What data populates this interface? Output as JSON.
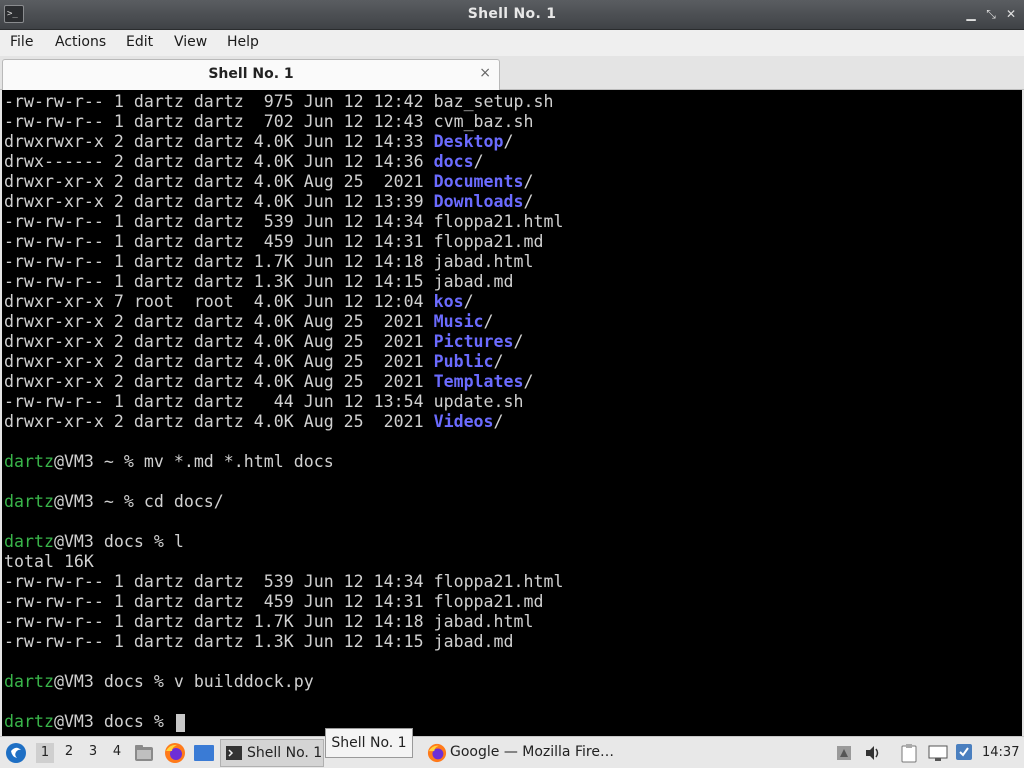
{
  "window": {
    "title": "Shell No. 1",
    "icon": "terminal-icon"
  },
  "menu": [
    "File",
    "Actions",
    "Edit",
    "View",
    "Help"
  ],
  "tab": {
    "label": "Shell No. 1",
    "close": "×"
  },
  "terminal": {
    "colors": {
      "directory": "#6b6bff",
      "user": "#39b54a",
      "text": "#d0d0d0"
    },
    "lines": [
      {
        "pre": "-rw-rw-r-- 1 dartz dartz  975 Jun 12 12:42 ",
        "name": "baz_setup.sh",
        "dir": false
      },
      {
        "pre": "-rw-rw-r-- 1 dartz dartz  702 Jun 12 12:43 ",
        "name": "cvm_baz.sh",
        "dir": false
      },
      {
        "pre": "drwxrwxr-x 2 dartz dartz 4.0K Jun 12 14:33 ",
        "name": "Desktop",
        "dir": true
      },
      {
        "pre": "drwx------ 2 dartz dartz 4.0K Jun 12 14:36 ",
        "name": "docs",
        "dir": true
      },
      {
        "pre": "drwxr-xr-x 2 dartz dartz 4.0K Aug 25  2021 ",
        "name": "Documents",
        "dir": true
      },
      {
        "pre": "drwxr-xr-x 2 dartz dartz 4.0K Jun 12 13:39 ",
        "name": "Downloads",
        "dir": true
      },
      {
        "pre": "-rw-rw-r-- 1 dartz dartz  539 Jun 12 14:34 ",
        "name": "floppa21.html",
        "dir": false
      },
      {
        "pre": "-rw-rw-r-- 1 dartz dartz  459 Jun 12 14:31 ",
        "name": "floppa21.md",
        "dir": false
      },
      {
        "pre": "-rw-rw-r-- 1 dartz dartz 1.7K Jun 12 14:18 ",
        "name": "jabad.html",
        "dir": false
      },
      {
        "pre": "-rw-rw-r-- 1 dartz dartz 1.3K Jun 12 14:15 ",
        "name": "jabad.md",
        "dir": false
      },
      {
        "pre": "drwxr-xr-x 7 root  root  4.0K Jun 12 12:04 ",
        "name": "kos",
        "dir": true
      },
      {
        "pre": "drwxr-xr-x 2 dartz dartz 4.0K Aug 25  2021 ",
        "name": "Music",
        "dir": true
      },
      {
        "pre": "drwxr-xr-x 2 dartz dartz 4.0K Aug 25  2021 ",
        "name": "Pictures",
        "dir": true
      },
      {
        "pre": "drwxr-xr-x 2 dartz dartz 4.0K Aug 25  2021 ",
        "name": "Public",
        "dir": true
      },
      {
        "pre": "drwxr-xr-x 2 dartz dartz 4.0K Aug 25  2021 ",
        "name": "Templates",
        "dir": true
      },
      {
        "pre": "-rw-rw-r-- 1 dartz dartz   44 Jun 12 13:54 ",
        "name": "update.sh",
        "dir": false
      },
      {
        "pre": "drwxr-xr-x 2 dartz dartz 4.0K Aug 25  2021 ",
        "name": "Videos",
        "dir": true
      },
      {
        "blank": true
      },
      {
        "user": "dartz",
        "rest": "@VM3 ~ % mv *.md *.html docs"
      },
      {
        "blank": true
      },
      {
        "user": "dartz",
        "rest": "@VM3 ~ % cd docs/"
      },
      {
        "blank": true
      },
      {
        "user": "dartz",
        "rest": "@VM3 docs % l"
      },
      {
        "text": "total 16K"
      },
      {
        "pre": "-rw-rw-r-- 1 dartz dartz  539 Jun 12 14:34 ",
        "name": "floppa21.html",
        "dir": false
      },
      {
        "pre": "-rw-rw-r-- 1 dartz dartz  459 Jun 12 14:31 ",
        "name": "floppa21.md",
        "dir": false
      },
      {
        "pre": "-rw-rw-r-- 1 dartz dartz 1.7K Jun 12 14:18 ",
        "name": "jabad.html",
        "dir": false
      },
      {
        "pre": "-rw-rw-r-- 1 dartz dartz 1.3K Jun 12 14:15 ",
        "name": "jabad.md",
        "dir": false
      },
      {
        "blank": true
      },
      {
        "user": "dartz",
        "rest": "@VM3 docs % v builddock.py"
      },
      {
        "blank": true
      },
      {
        "user": "dartz",
        "rest": "@VM3 docs % ",
        "cursor": true
      }
    ]
  },
  "taskbar": {
    "workspaces": [
      "1",
      "2",
      "3",
      "4"
    ],
    "active_workspace": "1",
    "tasks": [
      {
        "label": "Shell No. 1",
        "icon": "terminal-icon"
      },
      {
        "label": "Google — Mozilla Fire…",
        "icon": "firefox-icon"
      }
    ],
    "tooltip": "Shell No. 1",
    "clock": "14:37"
  }
}
